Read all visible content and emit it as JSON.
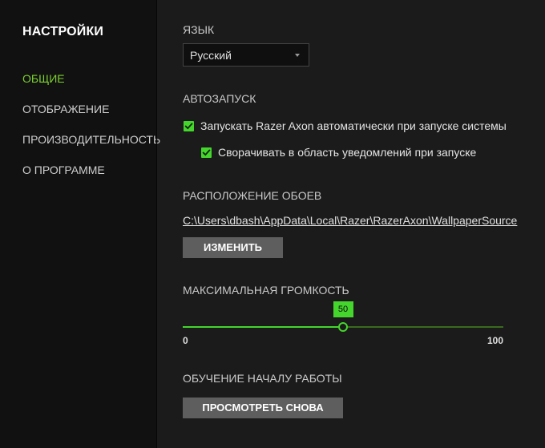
{
  "sidebar": {
    "title": "НАСТРОЙКИ",
    "items": [
      {
        "label": "ОБЩИЕ",
        "active": true
      },
      {
        "label": "ОТОБРАЖЕНИЕ",
        "active": false
      },
      {
        "label": "ПРОИЗВОДИТЕЛЬНОСТЬ",
        "active": false
      },
      {
        "label": "О ПРОГРАММЕ",
        "active": false
      }
    ]
  },
  "language": {
    "label": "ЯЗЫК",
    "selected": "Русский"
  },
  "autostart": {
    "label": "АВТОЗАПУСК",
    "option1": {
      "label": "Запускать Razer Axon автоматически при запуске системы",
      "checked": true
    },
    "option2": {
      "label": "Сворачивать в область уведомлений при запуске",
      "checked": true
    }
  },
  "wallpaper": {
    "label": "РАСПОЛОЖЕНИЕ ОБОЕВ",
    "path": "C:\\Users\\dbash\\AppData\\Local\\Razer\\RazerAxon\\WallpaperSource",
    "change_label": "ИЗМЕНИТЬ"
  },
  "volume": {
    "label": "МАКСИМАЛЬНАЯ ГРОМКОСТЬ",
    "value": 50,
    "value_text": "50",
    "min": 0,
    "max": 100,
    "min_label": "0",
    "max_label": "100"
  },
  "onboarding": {
    "label": "ОБУЧЕНИЕ НАЧАЛУ РАБОТЫ",
    "button_label": "ПРОСМОТРЕТЬ СНОВА"
  },
  "colors": {
    "accent": "#44d62c",
    "active_nav": "#7ccf2f",
    "sidebar_bg": "#111111",
    "content_bg": "#1b1b1b",
    "button_bg": "#5e5e5e"
  }
}
